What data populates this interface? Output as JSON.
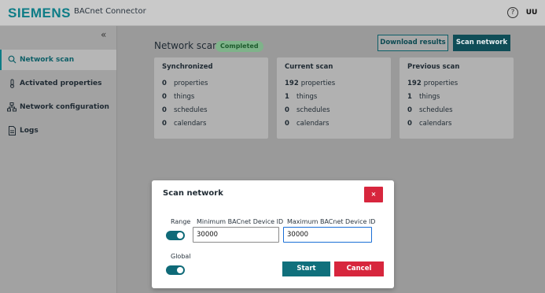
{
  "header": {
    "logo": "SIEMENS",
    "app_title": "BACnet Connector",
    "help_icon": "?",
    "user_initials": "UU"
  },
  "sidebar": {
    "collapse_icon": "«",
    "items": [
      {
        "label": "Network scan",
        "icon": "search-icon",
        "active": true
      },
      {
        "label": "Activated properties",
        "icon": "thermometer-icon"
      },
      {
        "label": "Network configuration",
        "icon": "network-icon"
      },
      {
        "label": "Logs",
        "icon": "log-file-icon"
      }
    ]
  },
  "main": {
    "title": "Network scan",
    "status": "Completed",
    "download_label": "Download results",
    "scan_label": "Scan network",
    "cards": [
      {
        "title": "Synchronized",
        "rows": [
          {
            "num": "0",
            "label": "properties"
          },
          {
            "num": "0",
            "label": "things"
          },
          {
            "num": "0",
            "label": "schedules"
          },
          {
            "num": "0",
            "label": "calendars"
          }
        ]
      },
      {
        "title": "Current scan",
        "rows": [
          {
            "num": "192",
            "label": "properties"
          },
          {
            "num": "1",
            "label": "things"
          },
          {
            "num": "0",
            "label": "schedules"
          },
          {
            "num": "0",
            "label": "calendars"
          }
        ]
      },
      {
        "title": "Previous scan",
        "rows": [
          {
            "num": "192",
            "label": "properties"
          },
          {
            "num": "1",
            "label": "things"
          },
          {
            "num": "0",
            "label": "schedules"
          },
          {
            "num": "0",
            "label": "calendars"
          }
        ]
      }
    ]
  },
  "dialog": {
    "title": "Scan network",
    "close_label": "×",
    "range_label": "Range",
    "min_label": "Minimum BACnet Device ID",
    "max_label": "Maximum BACnet Device ID",
    "min_value": "30000",
    "max_value": "30000",
    "global_label": "Global",
    "start_label": "Start",
    "cancel_label": "Cancel"
  },
  "colors": {
    "brand": "#0d7c86",
    "primary_button": "#0f4d57",
    "danger": "#d7263d",
    "badge_green": "#7fb38a"
  }
}
